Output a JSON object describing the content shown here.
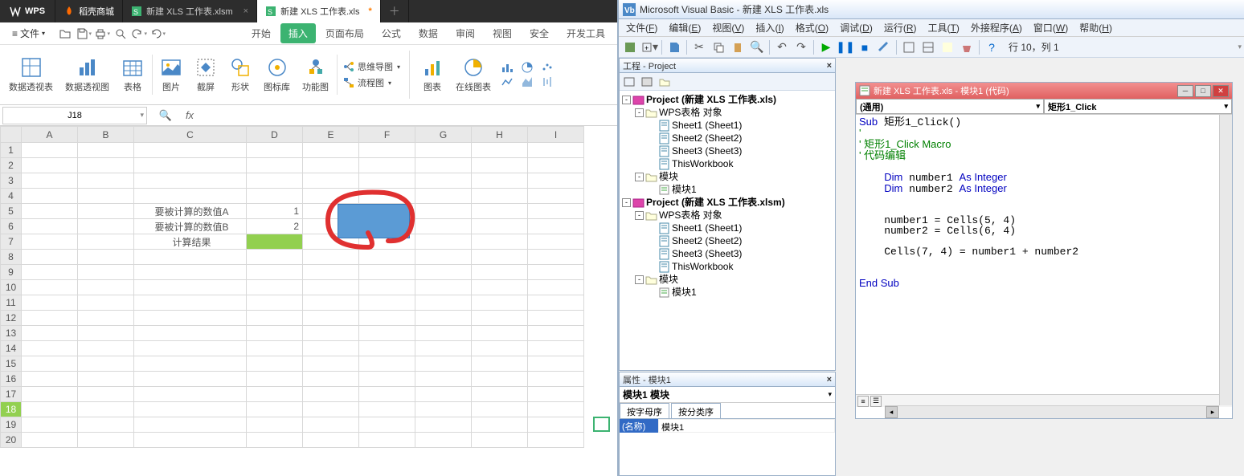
{
  "wps": {
    "tabs": {
      "logo": "WPS",
      "docker": "稻壳商城",
      "file1": "新建 XLS 工作表.xlsm",
      "file2": "新建 XLS 工作表.xls",
      "file2_dirty": "*"
    },
    "menu": {
      "file": "文件"
    },
    "ribbon_tabs": [
      "开始",
      "插入",
      "页面布局",
      "公式",
      "数据",
      "审阅",
      "视图",
      "安全",
      "开发工具"
    ],
    "ribbon_tab_active": "插入",
    "ribbon": {
      "pivot_table": "数据透视表",
      "pivot_chart": "数据透视图",
      "table": "表格",
      "picture": "图片",
      "screenshot": "截屏",
      "shapes": "形状",
      "icon_lib": "图标库",
      "func_icon": "功能图",
      "mindmap": "思维导图",
      "flowchart": "流程图",
      "chart": "图表",
      "online_chart": "在线图表"
    },
    "namebox": "J18",
    "fx": "fx",
    "cols": [
      "A",
      "B",
      "C",
      "D",
      "E",
      "F",
      "G",
      "H",
      "I"
    ],
    "rows": [
      "1",
      "2",
      "3",
      "4",
      "5",
      "6",
      "7",
      "8",
      "9",
      "10",
      "11",
      "12",
      "13",
      "14",
      "15",
      "16",
      "17",
      "18",
      "19",
      "20"
    ],
    "cells": {
      "c5": "要被计算的数值A",
      "c6": "要被计算的数值B",
      "c7": "计算结果",
      "d5": "1",
      "d6": "2"
    }
  },
  "vba": {
    "title": "Microsoft Visual Basic - 新建 XLS 工作表.xls",
    "menus": [
      {
        "t": "文件",
        "u": "F"
      },
      {
        "t": "编辑",
        "u": "E"
      },
      {
        "t": "视图",
        "u": "V"
      },
      {
        "t": "插入",
        "u": "I"
      },
      {
        "t": "格式",
        "u": "O"
      },
      {
        "t": "调试",
        "u": "D"
      },
      {
        "t": "运行",
        "u": "R"
      },
      {
        "t": "工具",
        "u": "T"
      },
      {
        "t": "外接程序",
        "u": "A"
      },
      {
        "t": "窗口",
        "u": "W"
      },
      {
        "t": "帮助",
        "u": "H"
      }
    ],
    "position": "行 10，列 1",
    "project_title": "工程 - Project",
    "tree": {
      "p1": "Project (新建 XLS 工作表.xls)",
      "p1_obj": "WPS表格 对象",
      "s1": "Sheet1 (Sheet1)",
      "s2": "Sheet2 (Sheet2)",
      "s3": "Sheet3 (Sheet3)",
      "wb": "ThisWorkbook",
      "mods": "模块",
      "m1": "模块1",
      "p2": "Project (新建 XLS 工作表.xlsm)"
    },
    "props": {
      "title": "属性 - 模块1",
      "obj": "模块1 模块",
      "tab1": "按字母序",
      "tab2": "按分类序",
      "key": "(名称)",
      "val": "模块1"
    },
    "code": {
      "title": "新建 XLS 工作表.xls - 模块1 (代码)",
      "dd_left": "(通用)",
      "dd_right": "矩形1_Click",
      "l1": "Sub 矩形1_Click()",
      "l2": "矩形1_Click Macro",
      "l3": "代码编辑",
      "l4": "Dim number1 As Integer",
      "l5": "Dim number2 As Integer",
      "l6": "number1 = Cells(5, 4)",
      "l7": "number2 = Cells(6, 4)",
      "l8": "Cells(7, 4) = number1 + number2",
      "l9": "End Sub"
    }
  }
}
